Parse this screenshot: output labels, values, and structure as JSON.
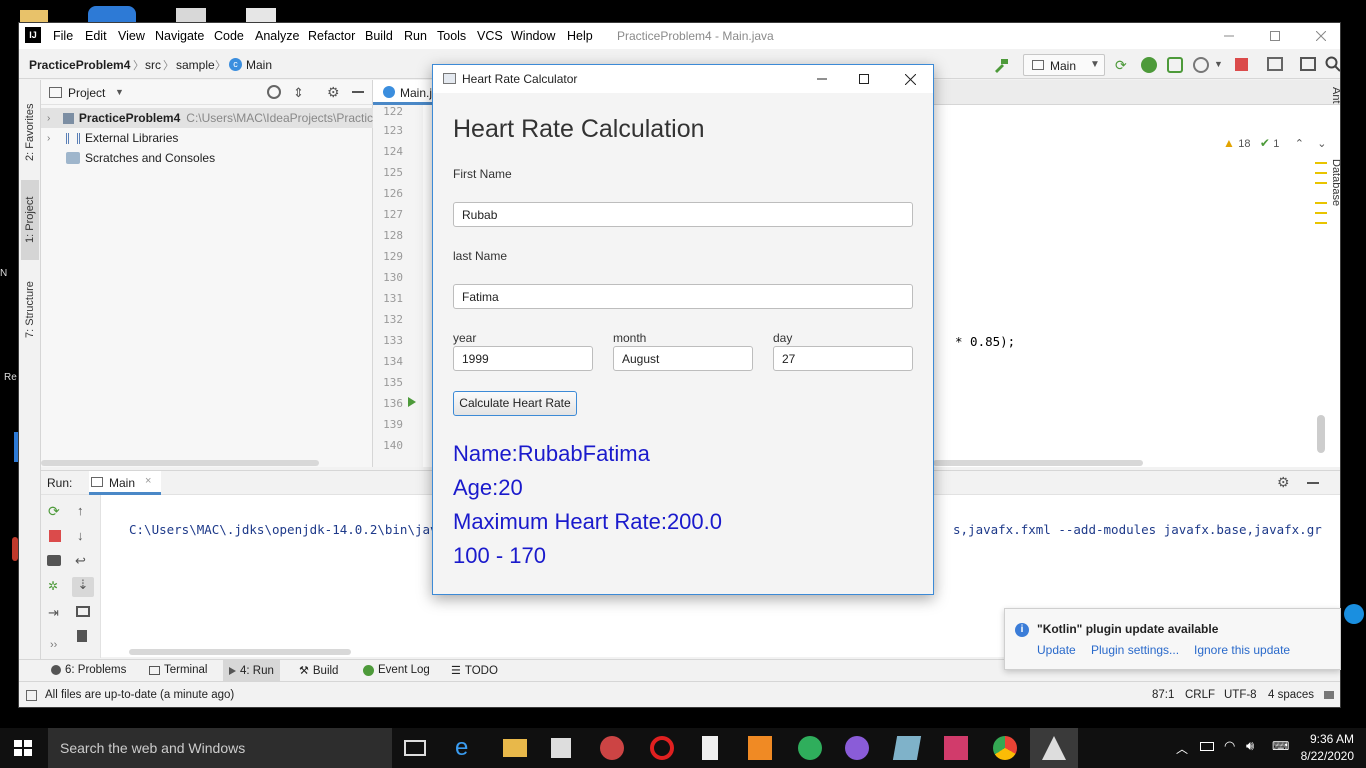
{
  "ide": {
    "menu": [
      "File",
      "Edit",
      "View",
      "Navigate",
      "Code",
      "Analyze",
      "Refactor",
      "Build",
      "Run",
      "Tools",
      "VCS",
      "Window",
      "Help"
    ],
    "window_title": "PracticeProblem4 - Main.java",
    "breadcrumb": [
      "PracticeProblem4",
      "src",
      "sample",
      "Main"
    ],
    "run_config": "Main",
    "left_tabs": [
      "2: Favorites",
      "1: Project",
      "7: Structure"
    ],
    "right_tabs": [
      "Ant",
      "Database"
    ],
    "project_panel": {
      "title": "Project",
      "tree": [
        {
          "label": "PracticeProblem4",
          "path": "C:\\Users\\MAC\\IdeaProjects\\Practic"
        },
        {
          "label": "External Libraries",
          "path": ""
        },
        {
          "label": "Scratches and Consoles",
          "path": ""
        }
      ]
    },
    "editor": {
      "tab": "Main.ja",
      "line_numbers": [
        "122",
        "123",
        "124",
        "125",
        "126",
        "127",
        "128",
        "129",
        "130",
        "131",
        "132",
        "133",
        "134",
        "135",
        "136",
        "139",
        "140"
      ],
      "visible_code": "* 0.85);",
      "warnings": "18",
      "checks": "1"
    },
    "run_panel": {
      "label": "Run:",
      "tab": "Main",
      "console_left": "C:\\Users\\MAC\\.jdks\\openjdk-14.0.2\\bin\\jav",
      "console_right": "s,javafx.fxml --add-modules javafx.base,javafx.gr"
    },
    "bottom_tabs": [
      "6: Problems",
      "Terminal",
      "4: Run",
      "Build",
      "Event Log",
      "TODO"
    ],
    "status": {
      "message": "All files are up-to-date (a minute ago)",
      "position": "87:1",
      "line_sep": "CRLF",
      "encoding": "UTF-8",
      "indent": "4 spaces"
    }
  },
  "dialog": {
    "title": "Heart Rate Calculator",
    "heading": "Heart Rate Calculation",
    "first_name_label": "First Name",
    "first_name_value": "Rubab",
    "last_name_label": "last Name",
    "last_name_value": "Fatima",
    "year_label": "year",
    "year_value": "1999",
    "month_label": "month",
    "month_value": "August",
    "day_label": "day",
    "day_value": "27",
    "button": "Calculate Heart Rate",
    "result_name": "Name:RubabFatima",
    "result_age": "Age:20",
    "result_max": "Maximum Heart Rate:200.0",
    "result_range": "100 - 170"
  },
  "notification": {
    "title": "\"Kotlin\" plugin update available",
    "actions": [
      "Update",
      "Plugin settings...",
      "Ignore this update"
    ]
  },
  "taskbar": {
    "search_placeholder": "Search the web and Windows",
    "time": "9:36 AM",
    "date": "8/22/2020"
  },
  "colors": {
    "accent": "#3c8ad6",
    "result_text": "#1a1acc",
    "link": "#2a6acb"
  }
}
